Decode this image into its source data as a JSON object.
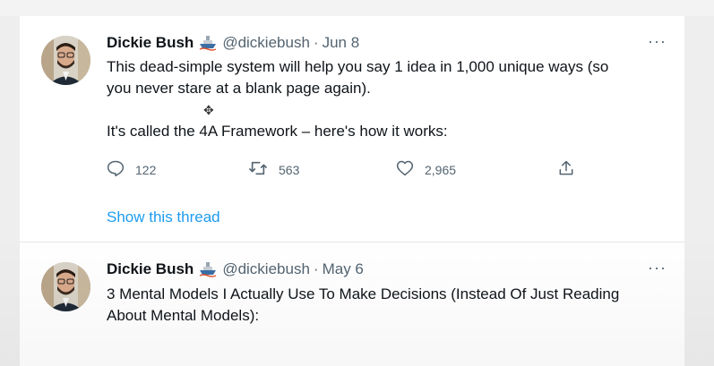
{
  "tweets": [
    {
      "name": "Dickie Bush",
      "handle": "@dickiebush",
      "separator": "·",
      "date": "Jun 8",
      "more": "···",
      "text_lines": [
        "This dead-simple system will help you say 1 idea in 1,000 unique ways (so",
        "you never stare at a blank page again).",
        "It's called the 4A Framework – here's how it works:"
      ],
      "replies": "122",
      "retweets": "563",
      "likes": "2,965",
      "show_thread": "Show this thread"
    },
    {
      "name": "Dickie Bush",
      "handle": "@dickiebush",
      "separator": "·",
      "date": "May 6",
      "more": "···",
      "text_lines": [
        "3 Mental Models I Actually Use To Make Decisions (Instead Of Just Reading",
        "About Mental Models):"
      ]
    }
  ],
  "icons": {
    "badge": "ship-icon",
    "reply": "reply-icon",
    "retweet": "retweet-icon",
    "like": "heart-icon",
    "share": "share-icon",
    "cursor": "move-cursor-icon"
  },
  "colors": {
    "link": "#1d9bf0",
    "muted": "#536471",
    "text": "#0f1419"
  }
}
